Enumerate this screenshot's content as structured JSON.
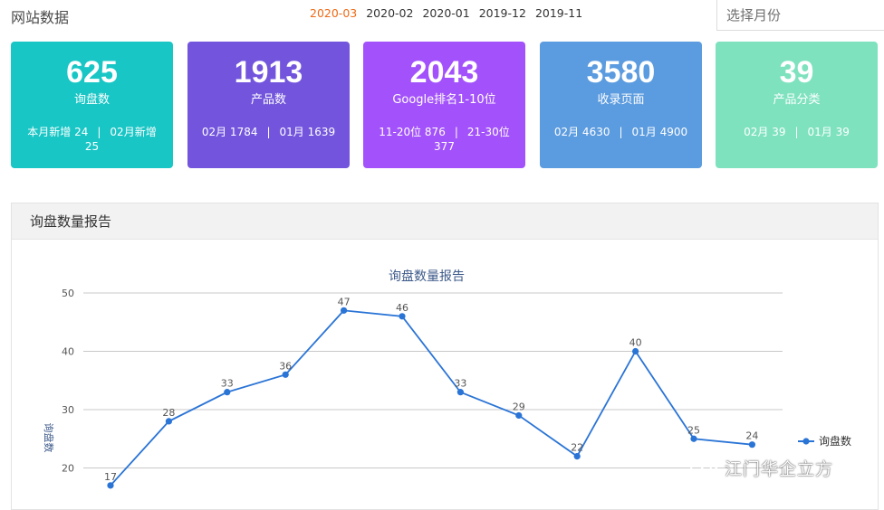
{
  "header": {
    "title": "网站数据",
    "months": [
      "2020-03",
      "2020-02",
      "2020-01",
      "2019-12",
      "2019-11"
    ],
    "active_month": "2020-03",
    "select_placeholder": "选择月份"
  },
  "cards": [
    {
      "value": "625",
      "label": "询盘数",
      "sub_a": "本月新增 24",
      "sub_b": "02月新增 25",
      "color": "#18c6c5"
    },
    {
      "value": "1913",
      "label": "产品数",
      "sub_a": "02月 1784",
      "sub_b": "01月 1639",
      "color": "#7355dd"
    },
    {
      "value": "2043",
      "label": "Google排名1-10位",
      "sub_a": "11-20位 876",
      "sub_b": "21-30位 377",
      "color": "#a352fb"
    },
    {
      "value": "3580",
      "label": "收录页面",
      "sub_a": "02月 4630",
      "sub_b": "01月 4900",
      "color": "#5b9bdf"
    },
    {
      "value": "39",
      "label": "产品分类",
      "sub_a": "02月 39",
      "sub_b": "01月 39",
      "color": "#7ee2bf"
    }
  ],
  "report": {
    "section_title": "询盘数量报告"
  },
  "chart_data": {
    "type": "line",
    "title": "询盘数量报告",
    "ylabel": "询盘数",
    "xlabel": "",
    "y_ticks": [
      20,
      30,
      40,
      50
    ],
    "ylim": [
      20,
      50
    ],
    "grid": true,
    "legend": "right",
    "series": [
      {
        "name": "询盘数",
        "color": "#2a74d6",
        "values": [
          17,
          28,
          33,
          36,
          47,
          46,
          33,
          29,
          22,
          40,
          25,
          24
        ]
      }
    ]
  },
  "watermark": {
    "text": "江门华企立方"
  }
}
